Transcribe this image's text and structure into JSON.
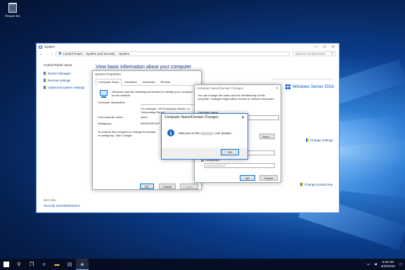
{
  "desktop": {
    "recycle_bin_label": "Recycle Bin"
  },
  "window": {
    "title": "System",
    "breadcrumb": [
      "Control Panel",
      "System and Security",
      "System"
    ],
    "search_placeholder": "Search Control Panel",
    "controls": {
      "minimize": "—",
      "maximize": "☐",
      "close": "✕"
    }
  },
  "left_nav": {
    "home": "Control Panel Home",
    "links": [
      "Device Manager",
      "Remote settings",
      "Advanced system settings"
    ],
    "see_also_label": "See also",
    "see_also_link": "Security and Maintenance"
  },
  "main": {
    "heading": "View basic information about your computer",
    "windows_server_label": "Windows Server 2016",
    "change_settings": "Change settings",
    "change_product_key": "Change product key"
  },
  "system_properties": {
    "title": "System Properties",
    "tabs": [
      "Computer Name",
      "Hardware",
      "Advanced",
      "Remote"
    ],
    "intro": "Windows uses the following information to identify your computer on the network.",
    "computer_description_label": "Computer description:",
    "example": "For example: \"IIS Production Server\" or \"Accounting Server\".",
    "full_computer_name_label": "Full computer name:",
    "full_computer_name_value": "user1",
    "workgroup_label": "Workgroup:",
    "workgroup_value": "WORKGROUP",
    "rename_text": "To rename this computer or change its domain or workgroup, click Change.",
    "buttons": {
      "ok": "OK",
      "cancel": "Cancel",
      "apply": "Apply"
    }
  },
  "domain_changes": {
    "title": "Computer Name/Domain Changes",
    "intro": "You can change the name and the membership of this computer. Changes might affect access to network resources.",
    "computer_name_label": "Computer name:",
    "more_button": "More...",
    "workgroup_label": "Workgroup:",
    "workgroup_value": "WORKGROUP",
    "buttons": {
      "ok": "OK",
      "cancel": "Cancel"
    }
  },
  "welcome_dialog": {
    "title": "Computer Name/Domain Changes",
    "message_prefix": "Welcome to the",
    "message_suffix": ".com domain.",
    "info_icon_glyph": "i",
    "ok_button": "OK",
    "close_glyph": "✕"
  },
  "taskbar": {
    "time": "5:45 AM",
    "date": "6/20/2018",
    "search_glyph": "⚲",
    "task_view_glyph": "❐",
    "edge_glyph": "e",
    "explorer_glyph": "▬",
    "server_manager_glyph": "▤",
    "shield_glyph": "◈",
    "network_glyph": "▭",
    "volume_glyph": "◀",
    "notification_glyph": "▢"
  },
  "colors": {
    "link": "#0a4aa0",
    "heading": "#1e3a8a",
    "accent": "#0078d7",
    "taskbar": "#060c1e"
  }
}
